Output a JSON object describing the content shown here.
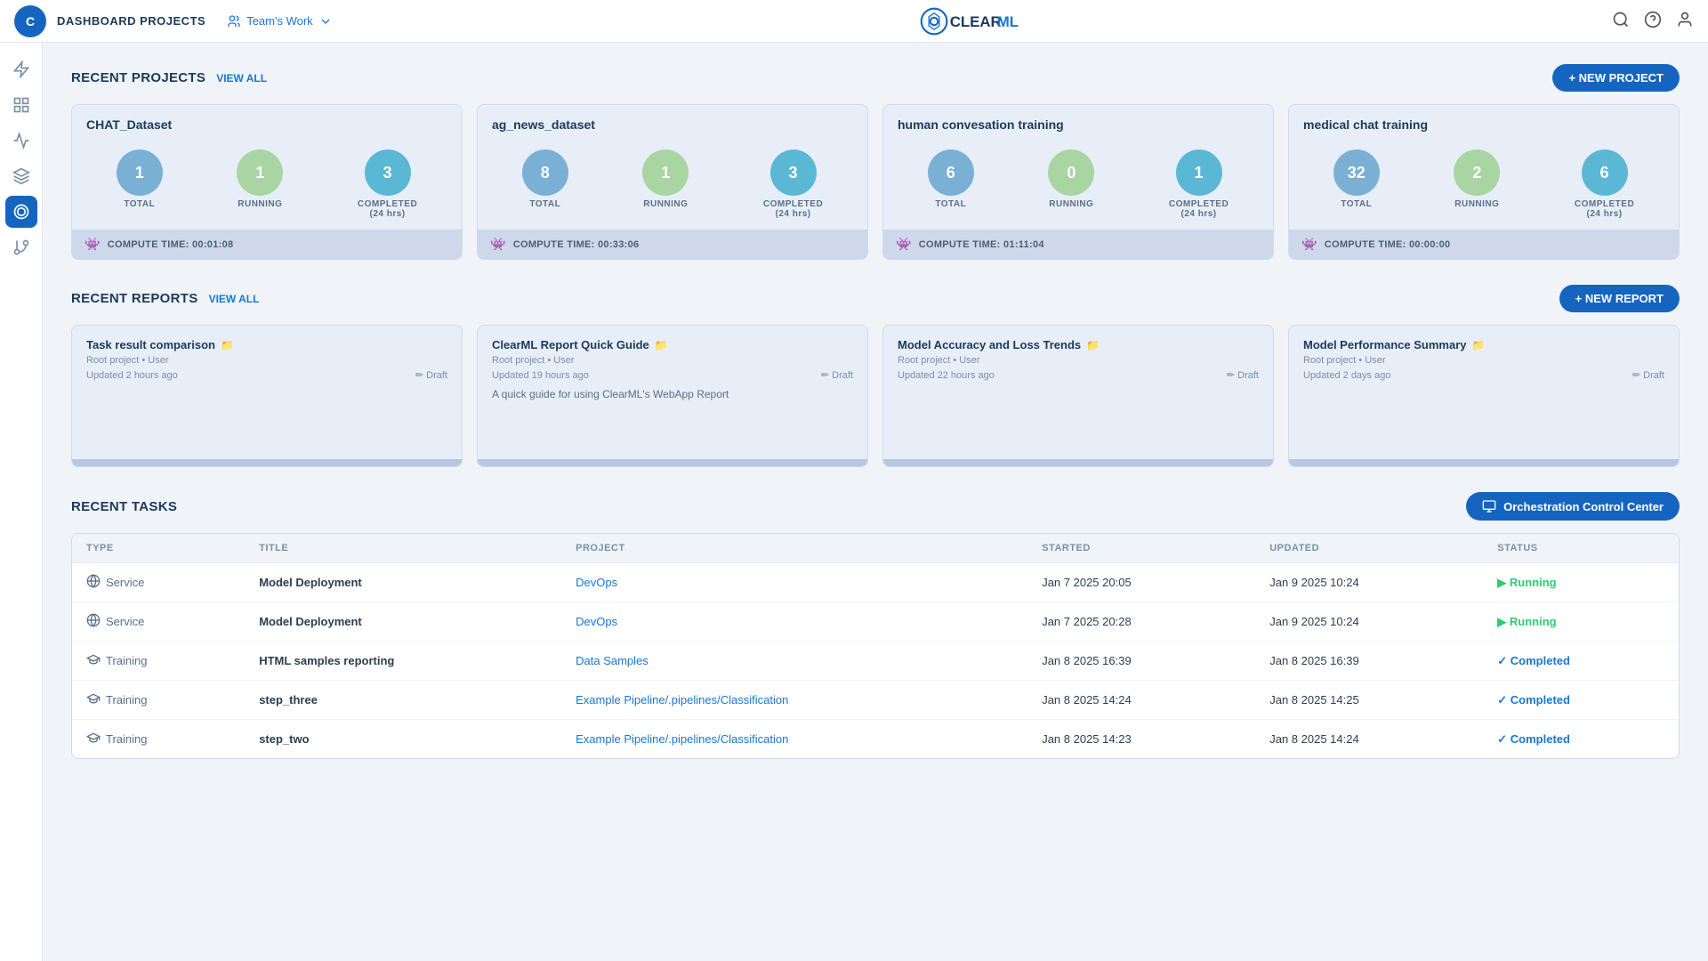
{
  "topnav": {
    "title": "DASHBOARD PROJECTS",
    "team_label": "Team's Work",
    "search_tooltip": "Search",
    "help_tooltip": "Help",
    "user_tooltip": "User"
  },
  "recent_projects": {
    "title": "RECENT PROJECTS",
    "view_all": "VIEW ALL",
    "new_button": "+ NEW PROJECT",
    "projects": [
      {
        "name": "CHAT_Dataset",
        "total": 1,
        "running": 1,
        "completed": 3,
        "compute_time": "COMPUTE TIME: 00:01:08"
      },
      {
        "name": "ag_news_dataset",
        "total": 8,
        "running": 1,
        "completed": 3,
        "compute_time": "COMPUTE TIME: 00:33:06"
      },
      {
        "name": "human convesation training",
        "total": 6,
        "running": 0,
        "completed": 1,
        "compute_time": "COMPUTE TIME: 01:11:04"
      },
      {
        "name": "medical chat training",
        "total": 32,
        "running": 2,
        "completed": 6,
        "compute_time": "COMPUTE TIME: 00:00:00"
      }
    ]
  },
  "recent_reports": {
    "title": "RECENT REPORTS",
    "view_all": "VIEW ALL",
    "new_button": "+ NEW REPORT",
    "reports": [
      {
        "title": "Task result comparison",
        "meta": "Root project • User",
        "updated": "Updated 2 hours ago",
        "status": "Draft",
        "desc": ""
      },
      {
        "title": "ClearML Report Quick Guide",
        "meta": "Root project • User",
        "updated": "Updated 19 hours ago",
        "status": "Draft",
        "desc": "A quick guide for using ClearML's WebApp Report"
      },
      {
        "title": "Model Accuracy and Loss Trends",
        "meta": "Root project • User",
        "updated": "Updated 22 hours ago",
        "status": "Draft",
        "desc": ""
      },
      {
        "title": "Model Performance Summary",
        "meta": "Root project • User",
        "updated": "Updated 2 days ago",
        "status": "Draft",
        "desc": ""
      }
    ]
  },
  "recent_tasks": {
    "title": "RECENT TASKS",
    "orchestration_button": "Orchestration Control Center",
    "columns": [
      "TYPE",
      "TITLE",
      "PROJECT",
      "STARTED",
      "UPDATED",
      "STATUS"
    ],
    "rows": [
      {
        "type": "Service",
        "type_icon": "globe",
        "title": "Model Deployment",
        "project": "DevOps",
        "started": "Jan 7 2025 20:05",
        "updated": "Jan 9 2025 10:24",
        "status": "Running",
        "status_type": "running"
      },
      {
        "type": "Service",
        "type_icon": "globe",
        "title": "Model Deployment",
        "project": "DevOps",
        "started": "Jan 7 2025 20:28",
        "updated": "Jan 9 2025 10:24",
        "status": "Running",
        "status_type": "running"
      },
      {
        "type": "Training",
        "type_icon": "graduation",
        "title": "HTML samples reporting",
        "project": "Data Samples",
        "started": "Jan 8 2025 16:39",
        "updated": "Jan 8 2025 16:39",
        "status": "Completed",
        "status_type": "completed"
      },
      {
        "type": "Training",
        "type_icon": "graduation",
        "title": "step_three",
        "project": "Example Pipeline/.pipelines/Classification",
        "started": "Jan 8 2025 14:24",
        "updated": "Jan 8 2025 14:25",
        "status": "Completed",
        "status_type": "completed"
      },
      {
        "type": "Training",
        "type_icon": "graduation",
        "title": "step_two",
        "project": "Example Pipeline/.pipelines/Classification",
        "started": "Jan 8 2025 14:23",
        "updated": "Jan 8 2025 14:24",
        "status": "Completed",
        "status_type": "completed"
      }
    ]
  },
  "sidebar": {
    "items": [
      {
        "name": "rocket",
        "label": "Experiments",
        "active": false
      },
      {
        "name": "grid",
        "label": "Projects",
        "active": false
      },
      {
        "name": "cloud",
        "label": "Models",
        "active": false
      },
      {
        "name": "layers",
        "label": "Datasets",
        "active": false
      },
      {
        "name": "brain",
        "label": "Applications",
        "active": true
      },
      {
        "name": "flow",
        "label": "Pipelines",
        "active": false
      }
    ]
  }
}
